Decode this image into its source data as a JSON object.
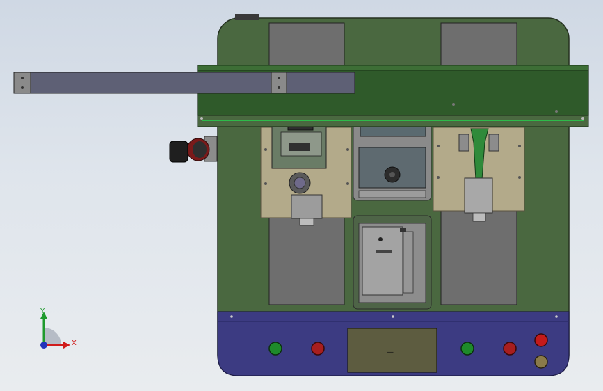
{
  "scene": {
    "colors": {
      "background_top": "#cfd8e4",
      "background_bottom": "#e9ecef",
      "frame_green": "#4a6840",
      "rail_green": "#2f5a2a",
      "control_panel": "#3c3b82",
      "plate": "#b3aa8a",
      "slot_gray": "#6e6e6e",
      "arm_gray": "#5e6075",
      "indicator_green": "#1e8a2a",
      "indicator_red": "#a81e1e"
    },
    "icons": {
      "triad": "coordinate-triad-icon",
      "knob": "adjustment-knob-icon",
      "motor": "stepper-motor-icon"
    }
  },
  "axes": {
    "x_label": "X",
    "y_label": "Y",
    "x_color": "#d01c1c",
    "y_color": "#1f9a2d",
    "z_color": "#2233bb"
  },
  "control_panel": {
    "display_text": "—",
    "indicator_count": 6
  }
}
